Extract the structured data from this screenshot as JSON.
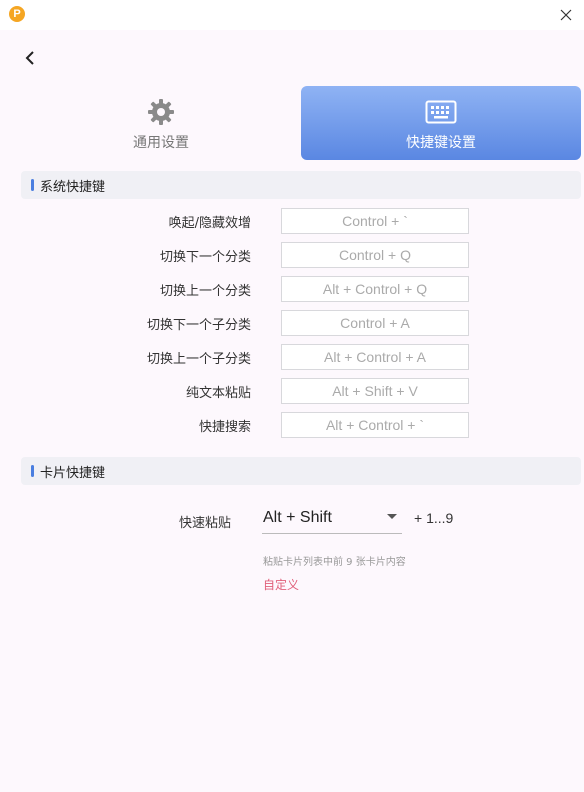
{
  "app": {
    "logo_letter": "P"
  },
  "tabs": [
    {
      "label": "通用设置",
      "icon": "gear-icon",
      "selected": false
    },
    {
      "label": "快捷键设置",
      "icon": "keyboard-icon",
      "selected": true
    }
  ],
  "system_section": {
    "title": "系统快捷键",
    "rows": [
      {
        "label": "唤起/隐藏效增",
        "shortcut": "Control + `"
      },
      {
        "label": "切换下一个分类",
        "shortcut": "Control + Q"
      },
      {
        "label": "切换上一个分类",
        "shortcut": "Alt + Control + Q"
      },
      {
        "label": "切换下一个子分类",
        "shortcut": "Control + A"
      },
      {
        "label": "切换上一个子分类",
        "shortcut": "Alt + Control + A"
      },
      {
        "label": "纯文本粘贴",
        "shortcut": "Alt + Shift + V"
      },
      {
        "label": "快捷搜索",
        "shortcut": "Alt + Control + `"
      }
    ]
  },
  "card_section": {
    "title": "卡片快捷键",
    "quick_paste_label": "快速粘贴",
    "modifier_value": "Alt + Shift",
    "range_text": "+ 1...9",
    "hint": "粘贴卡片列表中前 9 张卡片内容",
    "custom_link": "自定义"
  },
  "colors": {
    "accent": "#4a7ee0",
    "tab_gradient_top": "#8fb3f4",
    "tab_gradient_bottom": "#5a87e2",
    "link": "#e0607a",
    "background": "#fdf8fd"
  }
}
